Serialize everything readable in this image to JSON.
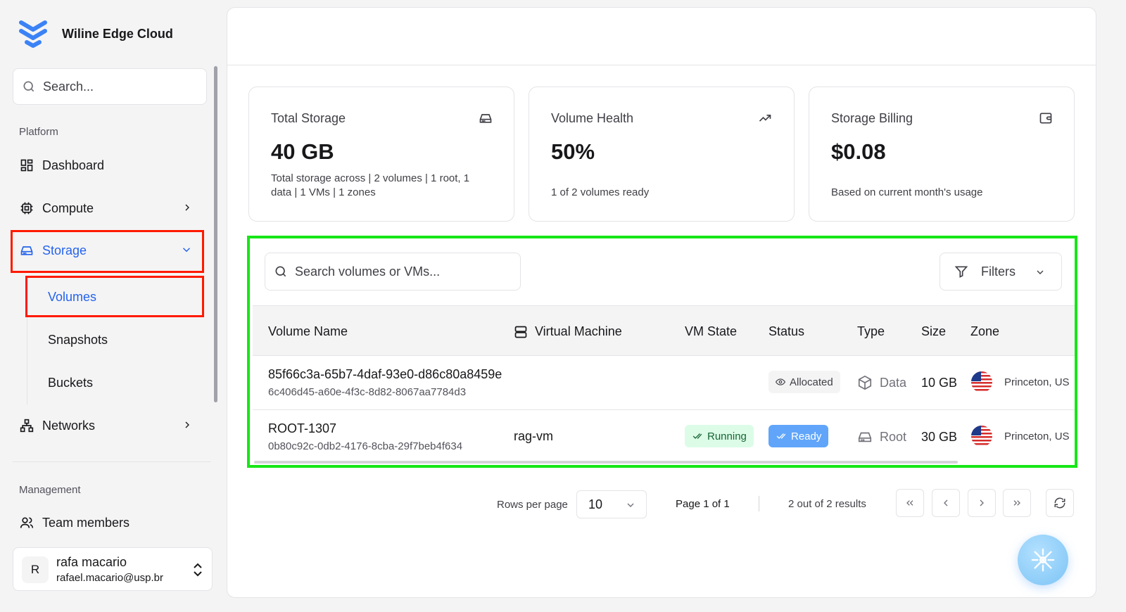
{
  "brand": {
    "title": "Wiline Edge Cloud",
    "accent": "#2563eb"
  },
  "sidebar": {
    "search_placeholder": "Search...",
    "platform_label": "Platform",
    "items": {
      "dashboard": "Dashboard",
      "compute": "Compute",
      "storage": "Storage",
      "networks": "Networks"
    },
    "storage_sub": {
      "volumes": "Volumes",
      "snapshots": "Snapshots",
      "buckets": "Buckets"
    },
    "management_label": "Management",
    "team_members": "Team members"
  },
  "user": {
    "initial": "R",
    "name": "rafa macario",
    "email": "rafael.macario@usp.br"
  },
  "cards": {
    "total_storage": {
      "title": "Total Storage",
      "value": "40 GB",
      "desc": "Total storage across | 2 volumes | 1 root, 1 data | 1 VMs | 1 zones",
      "icon": "hard-drive-icon"
    },
    "volume_health": {
      "title": "Volume Health",
      "value": "50%",
      "desc": "1 of 2 volumes ready",
      "icon": "trending-up-icon"
    },
    "storage_billing": {
      "title": "Storage Billing",
      "value": "$0.08",
      "desc": "Based on current month's usage",
      "icon": "wallet-icon"
    }
  },
  "table": {
    "search_placeholder": "Search volumes or VMs...",
    "filters_label": "Filters",
    "columns": {
      "volume_name": "Volume Name",
      "virtual_machine": "Virtual Machine",
      "vm_state": "VM State",
      "status": "Status",
      "type": "Type",
      "size": "Size",
      "zone": "Zone"
    },
    "rows": [
      {
        "name": "85f66c3a-65b7-4daf-93e0-d86c80a8459e",
        "id": "6c406d45-a60e-4f3c-8d82-8067aa7784d3",
        "vm": "",
        "vm_state": "",
        "status": "Allocated",
        "type": "Data",
        "size": "10 GB",
        "zone": "Princeton, US"
      },
      {
        "name": "ROOT-1307",
        "id": "0b80c92c-0db2-4176-8cba-29f7beb4f634",
        "vm": "rag-vm",
        "vm_state": "Running",
        "status": "Ready",
        "type": "Root",
        "size": "30 GB",
        "zone": "Princeton, US"
      }
    ]
  },
  "pagination": {
    "rows_per_page_label": "Rows per page",
    "rows_per_page_value": "10",
    "page_text": "Page 1 of 1",
    "results_text": "2 out of 2 results"
  }
}
